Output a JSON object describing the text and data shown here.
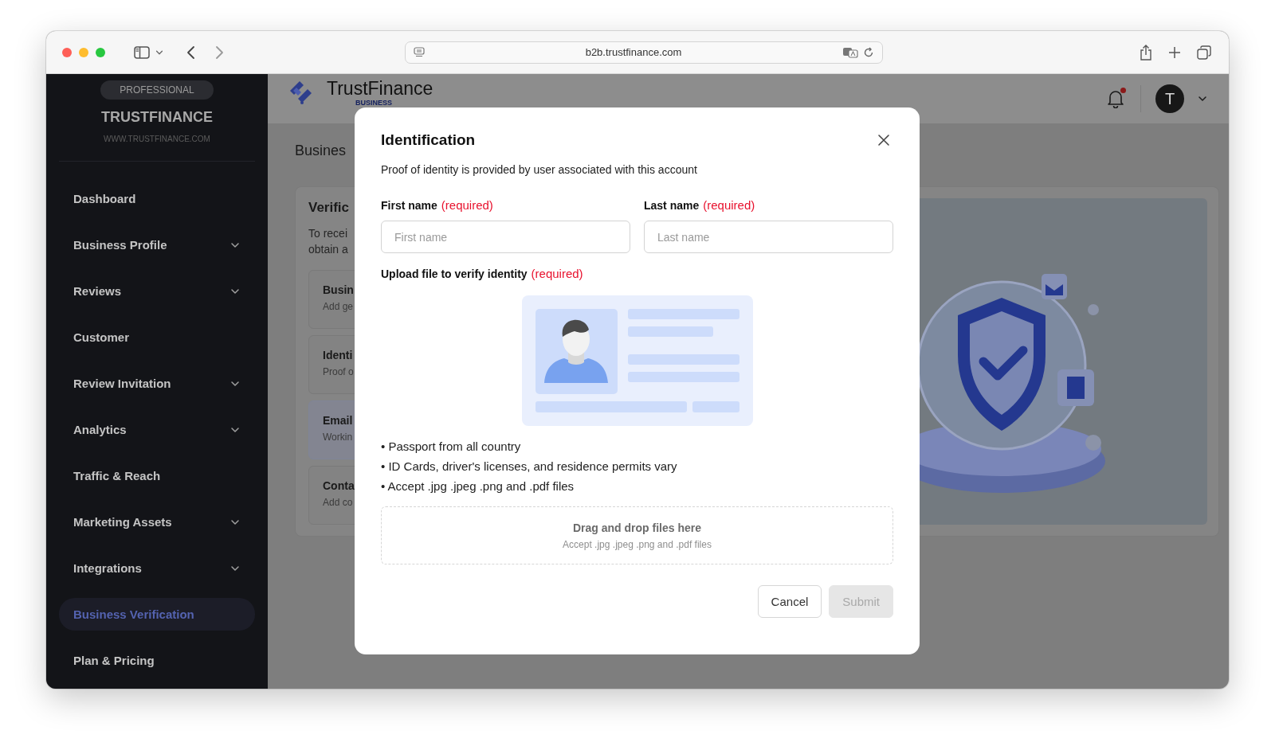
{
  "browser": {
    "url": "b2b.trustfinance.com"
  },
  "sidebar": {
    "badge": "PROFESSIONAL",
    "brand": "TRUSTFINANCE",
    "website": "WWW.TRUSTFINANCE.COM",
    "items": [
      {
        "label": "Dashboard",
        "expandable": false,
        "selected": false
      },
      {
        "label": "Business Profile",
        "expandable": true,
        "selected": false
      },
      {
        "label": "Reviews",
        "expandable": true,
        "selected": false
      },
      {
        "label": "Customer",
        "expandable": false,
        "selected": false
      },
      {
        "label": "Review Invitation",
        "expandable": true,
        "selected": false
      },
      {
        "label": "Analytics",
        "expandable": true,
        "selected": false
      },
      {
        "label": "Traffic & Reach",
        "expandable": false,
        "selected": false
      },
      {
        "label": "Marketing Assets",
        "expandable": true,
        "selected": false
      },
      {
        "label": "Integrations",
        "expandable": true,
        "selected": false
      },
      {
        "label": "Business Verification",
        "expandable": false,
        "selected": true
      },
      {
        "label": "Plan & Pricing",
        "expandable": false,
        "selected": false
      }
    ]
  },
  "header": {
    "logo_text": "TrustFinance",
    "logo_subtext": "BUSINESS",
    "has_notification": true,
    "avatar_initial": "T"
  },
  "page": {
    "title": "Busines",
    "section_title": "Verific",
    "intro": [
      "To recei",
      "obtain a"
    ],
    "cards": [
      {
        "title": "Busin",
        "subtitle": "Add ge",
        "highlighted": false
      },
      {
        "title": "Identi",
        "subtitle": "Proof o",
        "highlighted": false
      },
      {
        "title": "Email",
        "subtitle": "Workin",
        "highlighted": true
      },
      {
        "title": "Conta",
        "subtitle": "Add co",
        "highlighted": false
      }
    ]
  },
  "modal": {
    "title": "Identification",
    "description": "Proof of identity is provided by user associated with this account",
    "fields": [
      {
        "label": "First name",
        "note": "(required)",
        "placeholder": "First name"
      },
      {
        "label": "Last name",
        "note": "(required)",
        "placeholder": "Last name"
      }
    ],
    "upload_label": "Upload file to verify identity",
    "upload_note": "(required)",
    "requirements": [
      "• Passport from all country",
      "• ID Cards, driver's licenses, and residence permits vary",
      "• Accept .jpg .jpeg .png and .pdf files"
    ],
    "dropzone": {
      "title": "Drag and drop files here",
      "hint": "Accept .jpg .jpeg .png and .pdf files"
    },
    "buttons": [
      {
        "label": "Cancel",
        "kind": "secondary",
        "disabled": false
      },
      {
        "label": "Submit",
        "kind": "primary",
        "disabled": true
      }
    ]
  }
}
